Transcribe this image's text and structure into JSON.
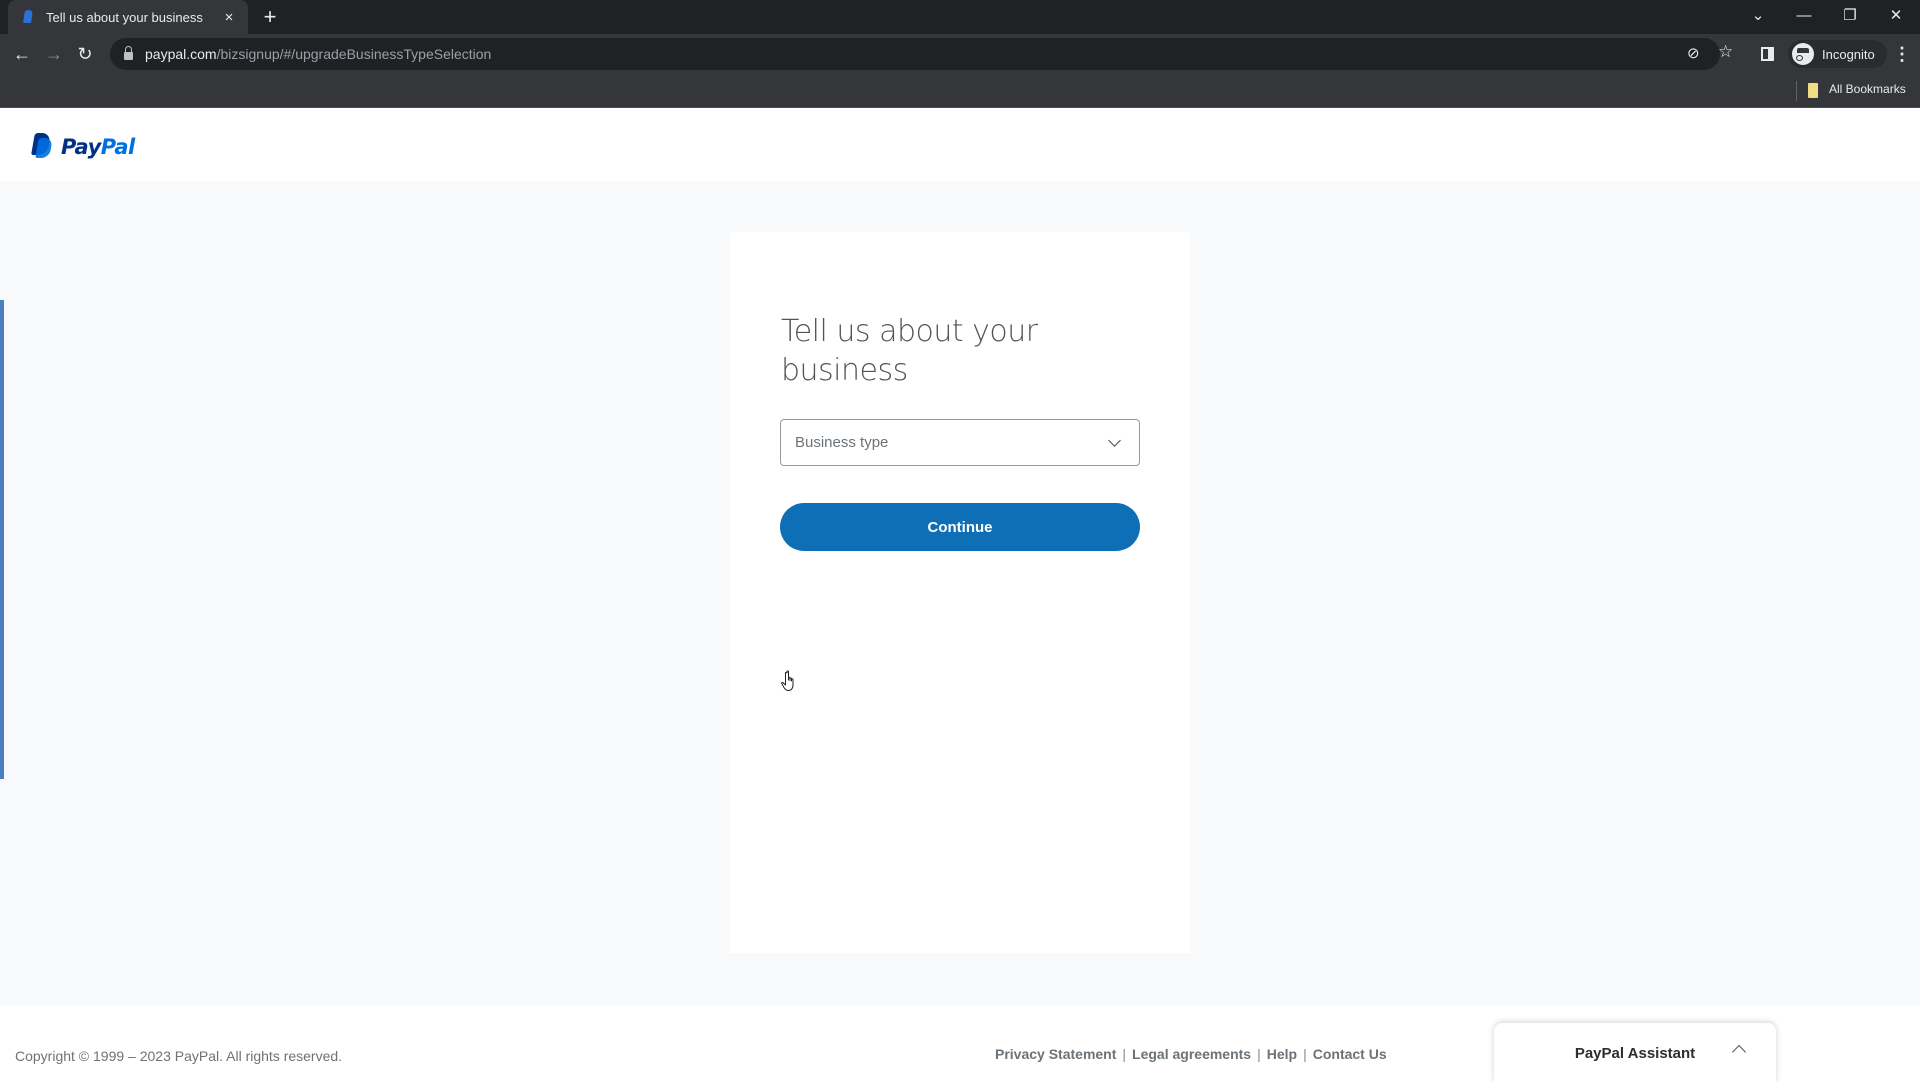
{
  "browser": {
    "tab_title": "Tell us about your business",
    "tab_close": "×",
    "new_tab": "+",
    "url_host": "paypal.com",
    "url_path": "/bizsignup/#/upgradeBusinessTypeSelection",
    "profile_label": "Incognito",
    "bookmarks_label": "All Bookmarks",
    "icons": {
      "back": "←",
      "forward": "→",
      "reload": "↻",
      "eye_off": "⊘",
      "star": "☆",
      "menu": "⋮",
      "tab_search": "⌄",
      "minimize": "—",
      "restore": "❐",
      "close": "✕"
    }
  },
  "header": {
    "logo_pay": "Pay",
    "logo_pal": "Pal"
  },
  "form": {
    "heading": "Tell us about your business",
    "business_type_placeholder": "Business type",
    "continue_label": "Continue"
  },
  "footer": {
    "copyright": "Copyright © 1999 – 2023 PayPal. All rights reserved.",
    "links": [
      "Privacy Statement",
      "Legal agreements",
      "Help",
      "Contact Us"
    ],
    "separator": "|"
  },
  "assistant": {
    "label": "PayPal Assistant"
  },
  "colors": {
    "brand_dark": "#003087",
    "brand_light": "#0070e0",
    "button": "#0f6fb6",
    "page_bg": "#f7f9fa"
  }
}
